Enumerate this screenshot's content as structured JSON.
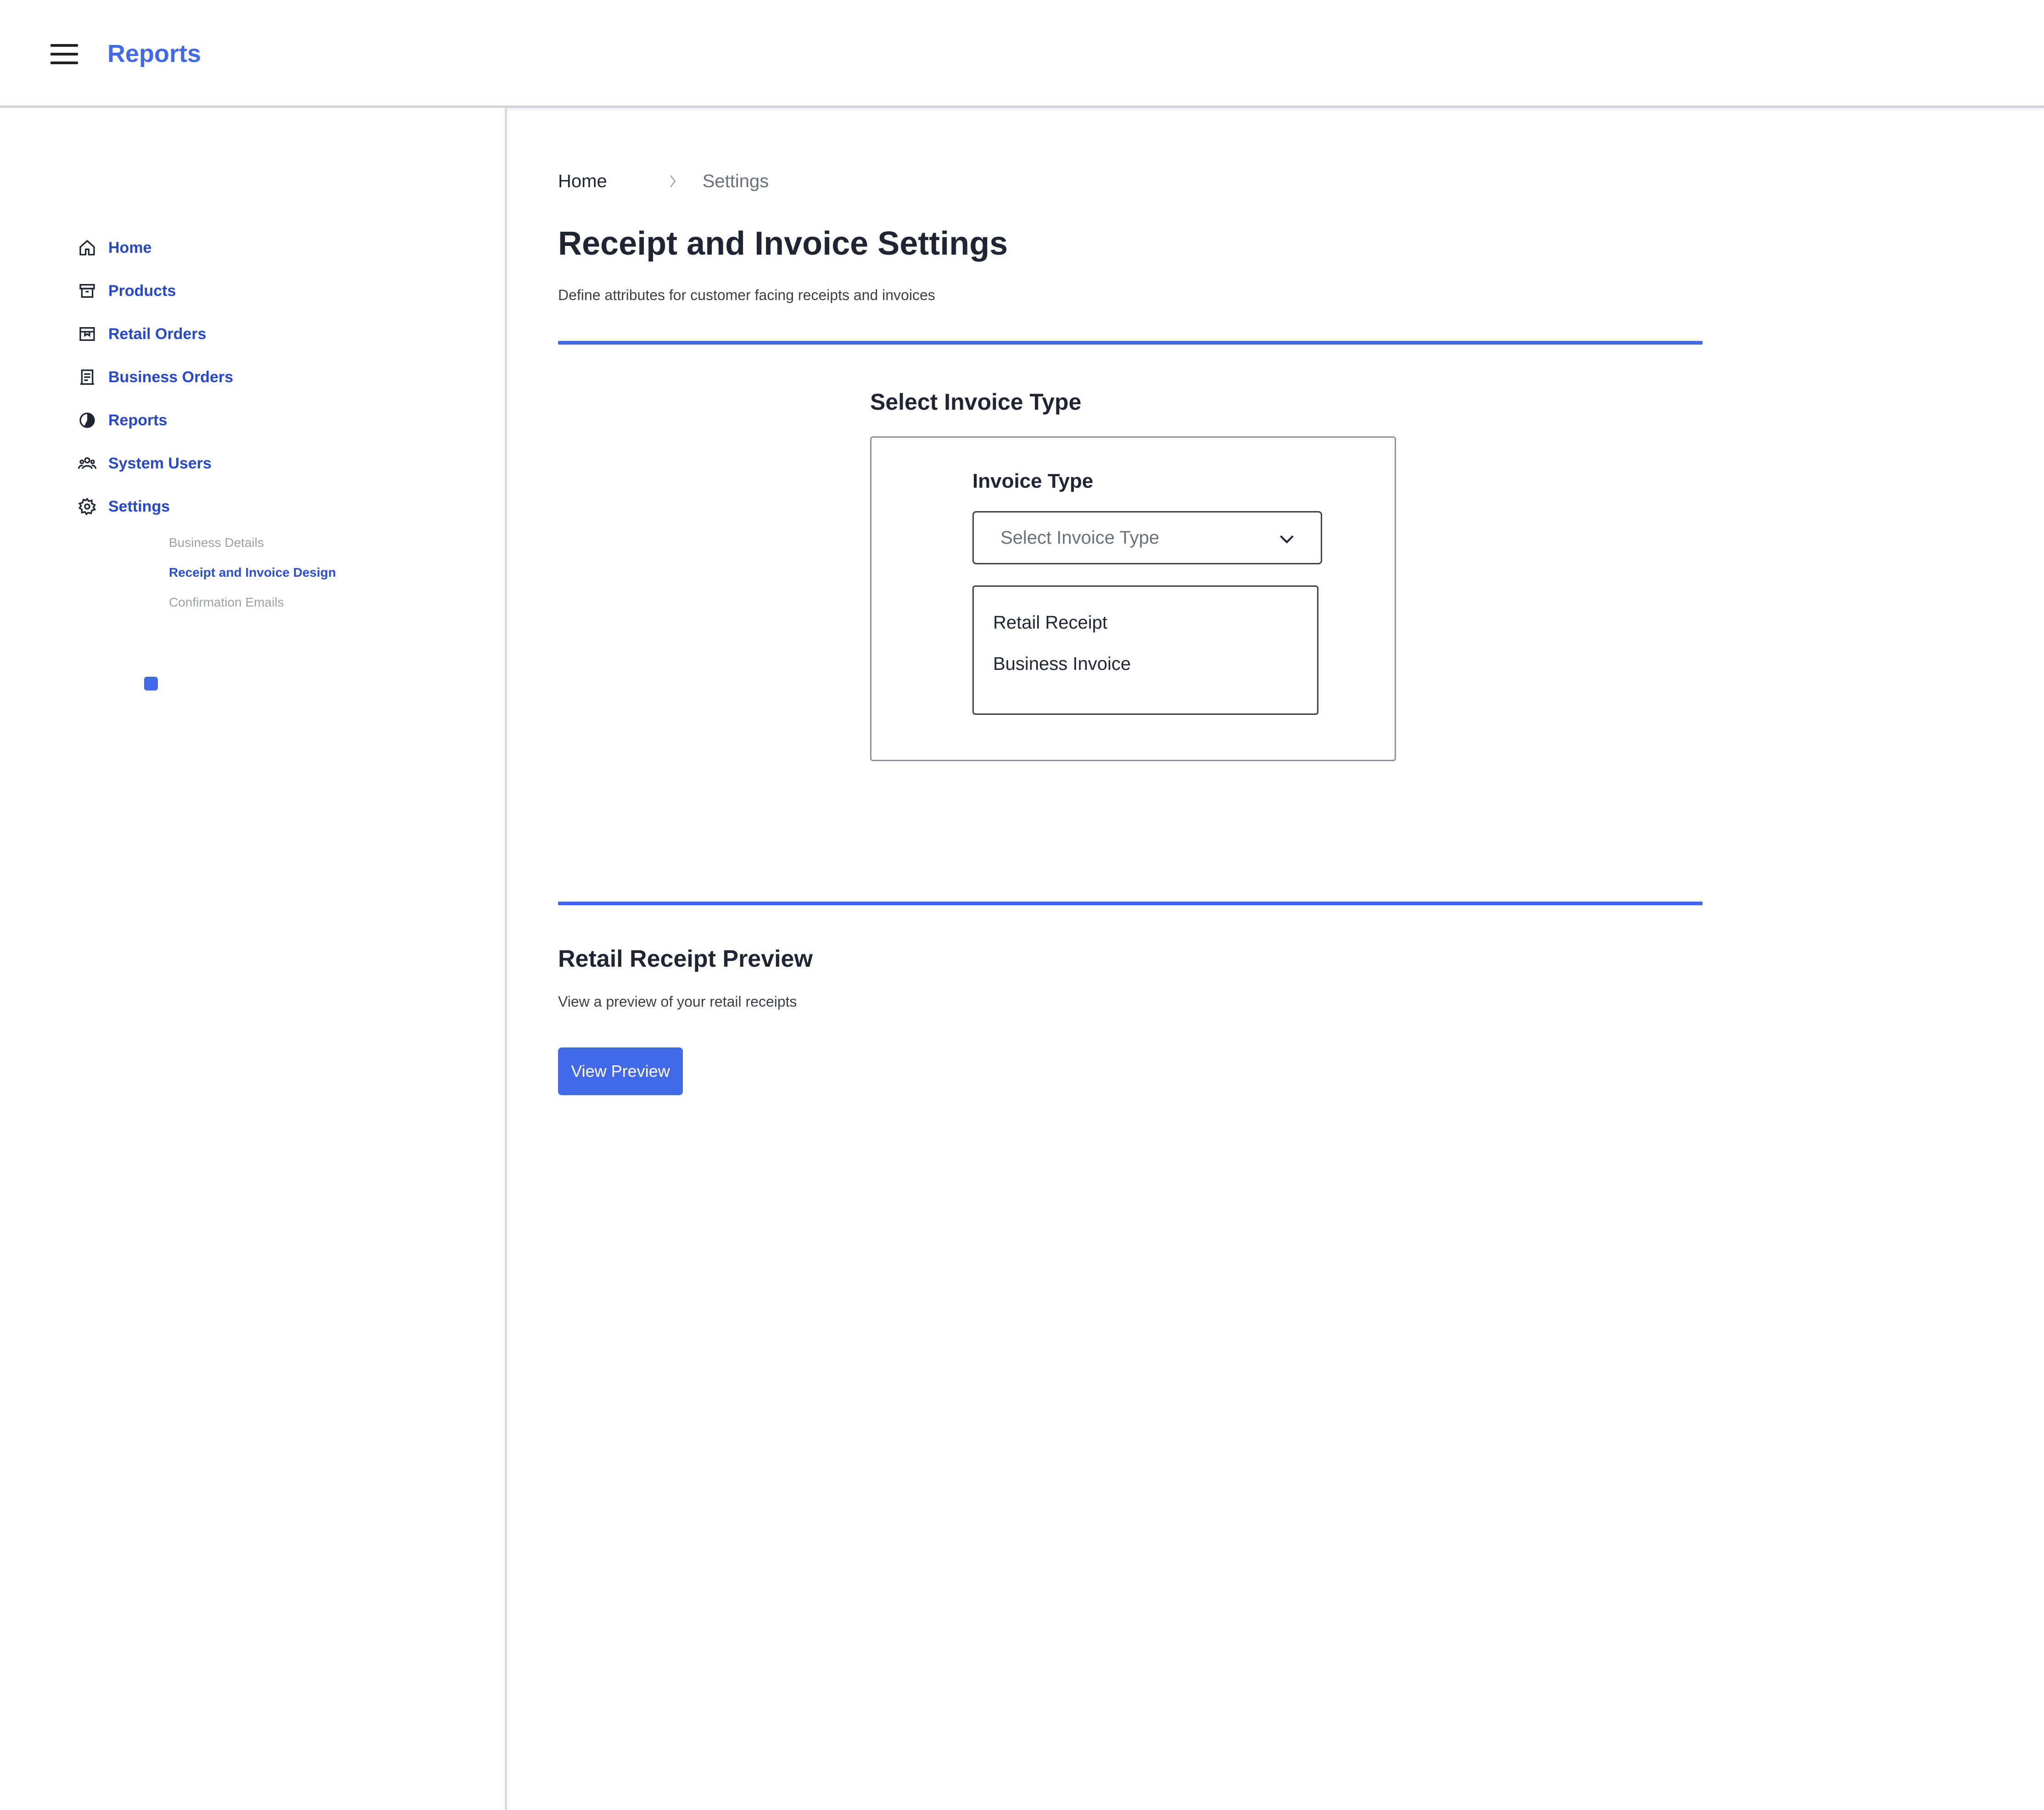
{
  "app": {
    "title": "Reports"
  },
  "colors": {
    "accent": "#4169ea",
    "nav_text": "#2748c8",
    "muted": "#9aa0aa"
  },
  "sidebar": {
    "items": [
      {
        "label": "Home",
        "icon": "home-icon"
      },
      {
        "label": "Products",
        "icon": "archive-icon"
      },
      {
        "label": "Retail Orders",
        "icon": "box-icon"
      },
      {
        "label": "Business Orders",
        "icon": "receipt-icon"
      },
      {
        "label": "Reports",
        "icon": "pie-chart-icon"
      },
      {
        "label": "System Users",
        "icon": "users-icon"
      },
      {
        "label": "Settings",
        "icon": "gear-icon"
      }
    ],
    "sub_items": [
      {
        "label": "Business Details",
        "active": false
      },
      {
        "label": "Receipt and Invoice Design",
        "active": true
      },
      {
        "label": "Confirmation Emails",
        "active": false
      }
    ]
  },
  "breadcrumb": {
    "home": "Home",
    "current": "Settings"
  },
  "page": {
    "title": "Receipt and Invoice Settings",
    "subtitle": "Define attributes for customer facing receipts and invoices"
  },
  "invoice_section": {
    "title": "Select Invoice Type",
    "field_label": "Invoice Type",
    "select_placeholder": "Select Invoice Type",
    "options": [
      "Retail Receipt",
      "Business Invoice"
    ]
  },
  "preview_section": {
    "title": "Retail Receipt Preview",
    "subtitle": "View a preview of your retail receipts",
    "button_label": "View Preview"
  }
}
